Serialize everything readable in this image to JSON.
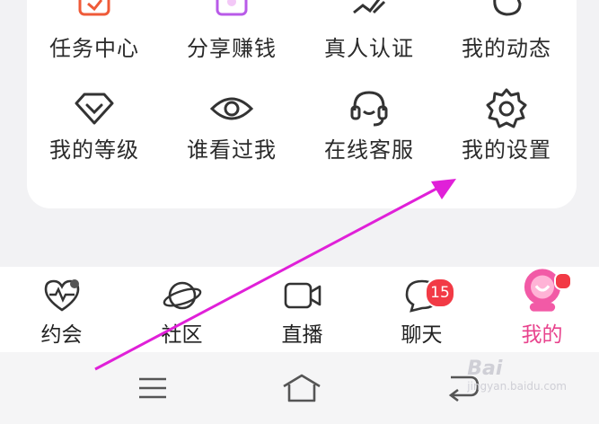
{
  "grid": {
    "row1": [
      {
        "label": "任务中心",
        "icon": "task-center-icon"
      },
      {
        "label": "分享赚钱",
        "icon": "share-earn-icon"
      },
      {
        "label": "真人认证",
        "icon": "verify-icon"
      },
      {
        "label": "我的动态",
        "icon": "moments-icon"
      }
    ],
    "row2": [
      {
        "label": "我的等级",
        "icon": "diamond-level-icon"
      },
      {
        "label": "谁看过我",
        "icon": "eye-icon"
      },
      {
        "label": "在线客服",
        "icon": "headset-icon"
      },
      {
        "label": "我的设置",
        "icon": "gear-icon"
      }
    ]
  },
  "tabs": [
    {
      "label": "约会",
      "icon": "heart-pulse-icon"
    },
    {
      "label": "社区",
      "icon": "planet-icon"
    },
    {
      "label": "直播",
      "icon": "video-camera-icon"
    },
    {
      "label": "聊天",
      "icon": "chat-bubble-icon",
      "badge": "15"
    },
    {
      "label": "我的",
      "icon": "mascot-icon",
      "active": true
    }
  ],
  "watermark": {
    "text": "Bai",
    "sub": "jingyan.baidu.com"
  },
  "colors": {
    "accent": "#e8438d",
    "badge": "#f23a45",
    "arrow": "#e020d8",
    "task_icon": "#ef5a38",
    "share_icon": "#b85ae8"
  }
}
